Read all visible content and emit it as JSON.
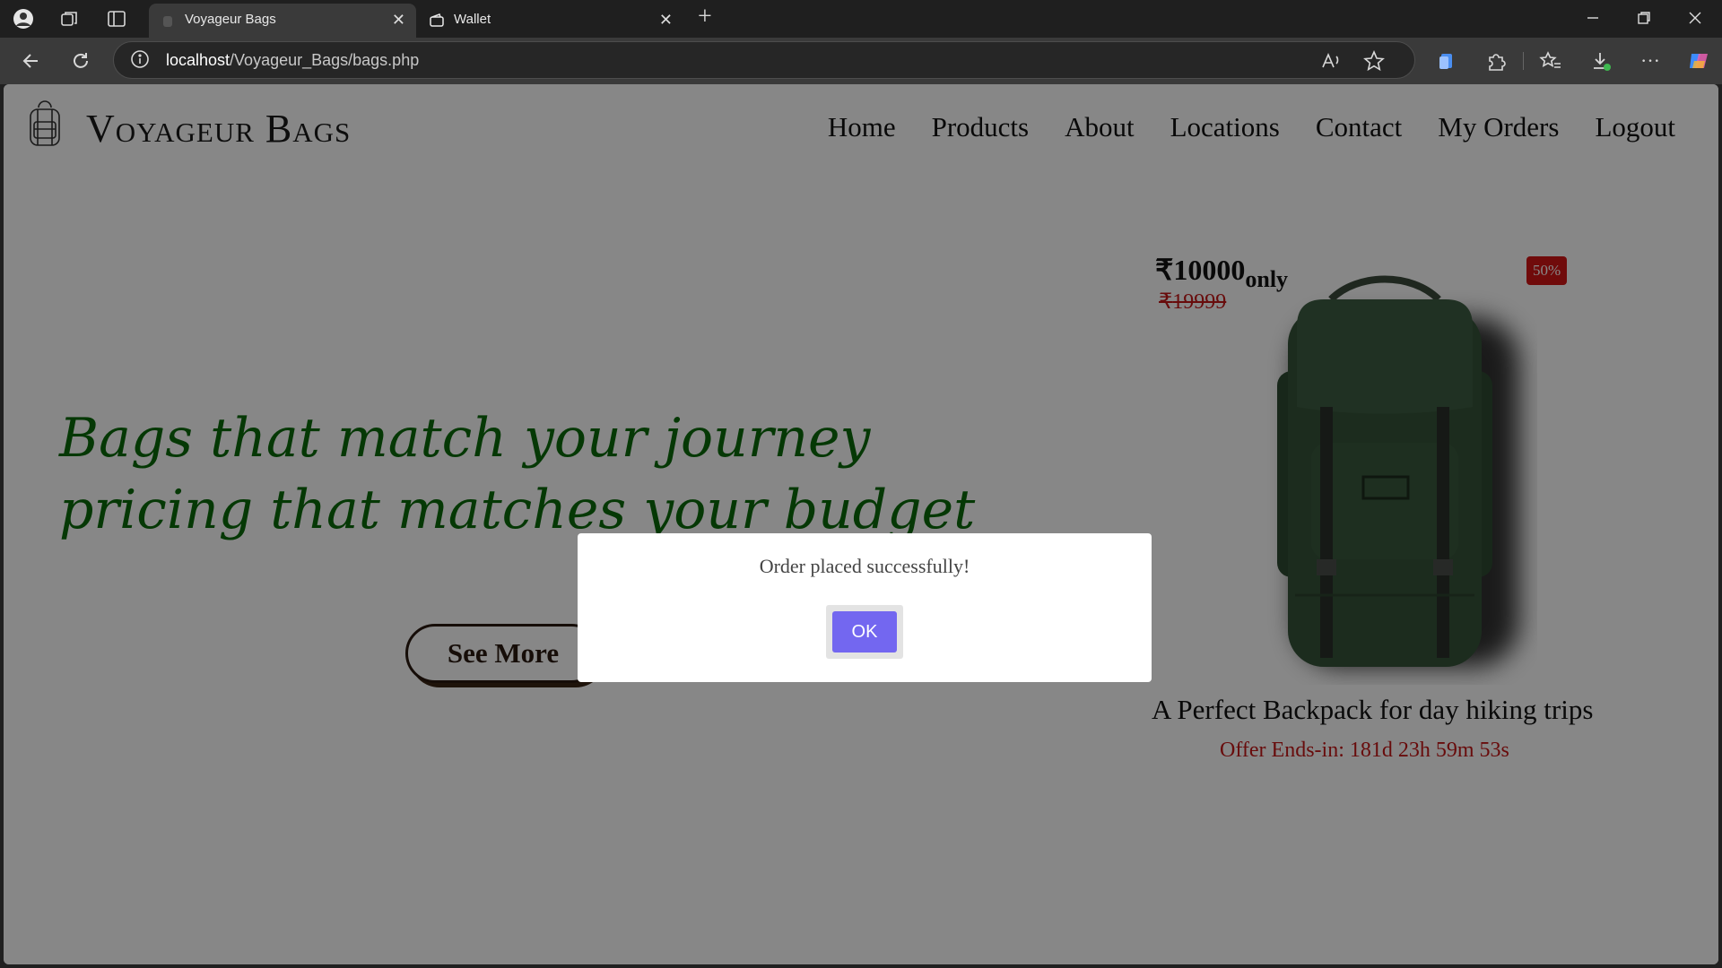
{
  "browser": {
    "tabs": [
      {
        "title": "Voyageur Bags",
        "active": true
      },
      {
        "title": "Wallet",
        "active": false
      }
    ],
    "url_host": "localhost",
    "url_path": "/Voyageur_Bags/bags.php"
  },
  "site": {
    "brand": "Voyageur Bags",
    "nav": [
      "Home",
      "Products",
      "About",
      "Locations",
      "Contact",
      "My Orders",
      "Logout"
    ]
  },
  "hero": {
    "headline_line1": "Bags that match your journey",
    "headline_line2": "pricing that matches your budget",
    "cta_label": "See More"
  },
  "product": {
    "price_symbol": "₹",
    "price": "10000",
    "price_suffix": "only",
    "old_price": "19999",
    "discount": "50%",
    "caption": "A Perfect Backpack for day hiking trips",
    "countdown": "Offer Ends-in: 181d 23h 59m 53s"
  },
  "dialog": {
    "message": "Order placed successfully!",
    "ok_label": "OK"
  },
  "colors": {
    "headline": "#0b6b0b",
    "price_strike": "#c41818",
    "discount_badge": "#d31515",
    "ok_button": "#7367f0"
  }
}
